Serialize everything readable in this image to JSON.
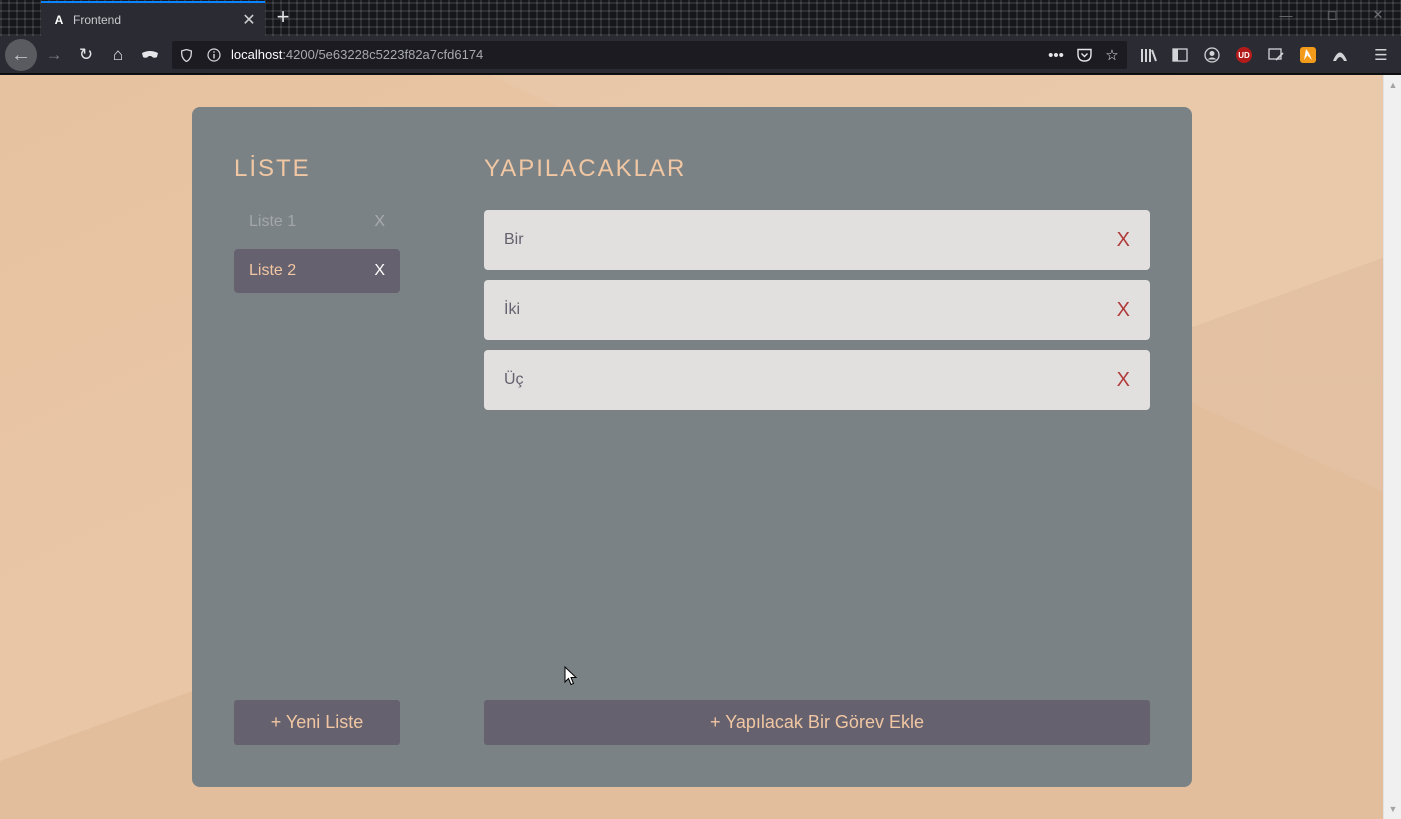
{
  "browser": {
    "tab_title": "Frontend",
    "tab_favicon": "A",
    "tab_close": "✕",
    "new_tab": "+",
    "url_host": "localhost",
    "url_path": ":4200/5e63228c5223f82a7cfd6174",
    "badge_ublock": "UD"
  },
  "app": {
    "list_heading": "LİSTE",
    "todo_heading": "YAPILACAKLAR",
    "lists": [
      {
        "label": "Liste 1",
        "delete": "X",
        "active": false
      },
      {
        "label": "Liste 2",
        "delete": "X",
        "active": true
      }
    ],
    "tasks": [
      {
        "label": "Bir",
        "delete": "X"
      },
      {
        "label": "İki",
        "delete": "X"
      },
      {
        "label": "Üç",
        "delete": "X"
      }
    ],
    "new_list_button": "+ Yeni Liste",
    "add_task_button": "+ Yapılacak Bir Görev Ekle"
  },
  "colors": {
    "page_bg": "#e8c6a6",
    "card_bg": "#7b8285",
    "accent": "#f1c7a3",
    "button_bg": "#66616e",
    "task_bg": "#e2e0df",
    "delete_red": "#b03a3a"
  }
}
